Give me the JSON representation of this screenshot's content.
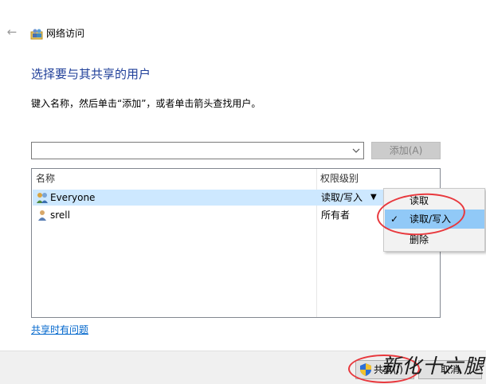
{
  "header": {
    "back_glyph": "←",
    "title": "网络访问"
  },
  "heading": "选择要与其共享的用户",
  "instruction": "键入名称，然后单击“添加”，或者单击箭头查找用户。",
  "combo": {
    "value": "",
    "arrow_glyph": "⌄"
  },
  "add_button": "添加(A)",
  "list": {
    "columns": [
      "名称",
      "权限级别"
    ],
    "rows": [
      {
        "name": "Everyone",
        "permission": "读取/写入",
        "icon": "group-users-icon",
        "selected": true
      },
      {
        "name": "srell",
        "permission": "所有者",
        "icon": "user-icon",
        "selected": false
      }
    ],
    "dropdown_glyph": "▼"
  },
  "permission_menu": {
    "items": [
      {
        "label": "读取",
        "checked": false
      },
      {
        "label": "读取/写入",
        "checked": true
      },
      {
        "label": "删除",
        "checked": false
      }
    ],
    "check_glyph": "✓"
  },
  "help_link": "共享时有问题",
  "footer": {
    "share_button": "共享(I)",
    "cancel_button": "取消"
  },
  "watermark": "新化十六腿",
  "colors": {
    "heading": "#1f3f99",
    "selection": "#cde8ff",
    "menu_highlight": "#91c9f7",
    "annotation": "#e8383d",
    "link": "#0066cc"
  }
}
